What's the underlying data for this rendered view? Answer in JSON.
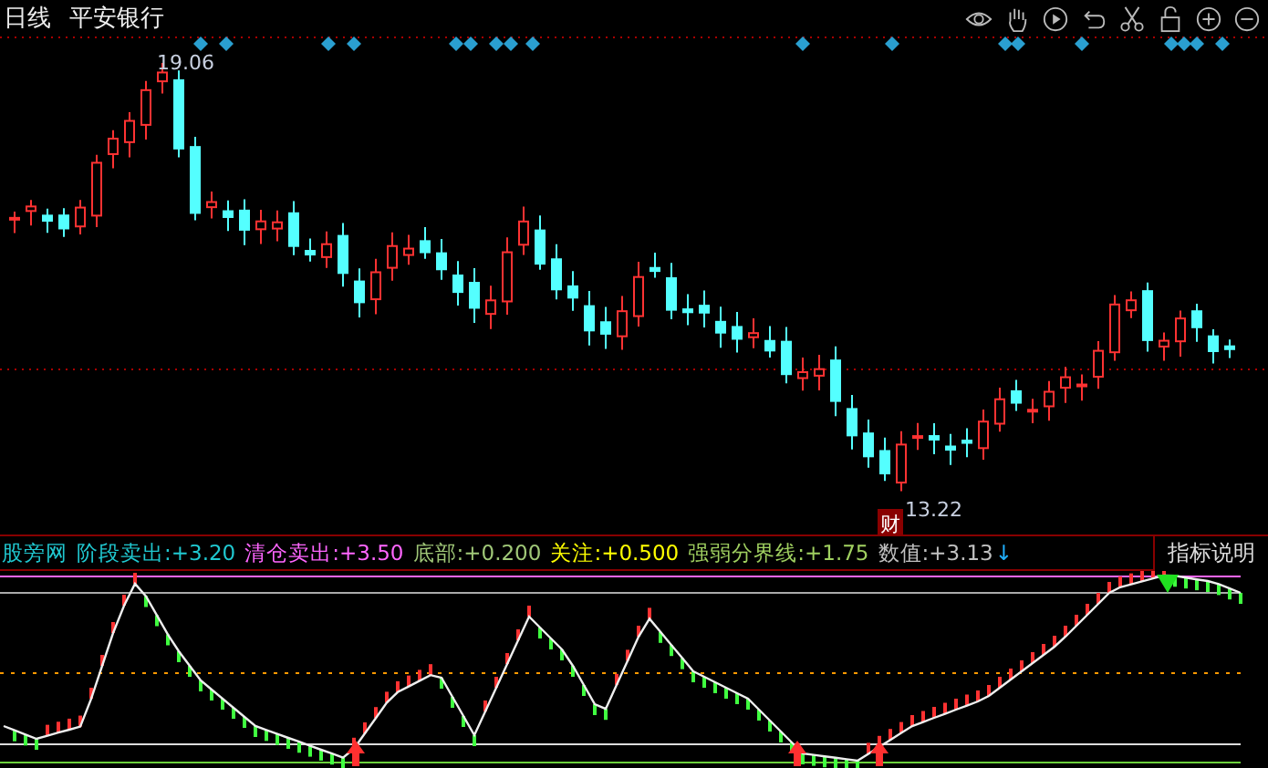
{
  "header": {
    "period": "日线",
    "stock": "平安银行"
  },
  "price_chart": {
    "high_label": "19.06",
    "low_label": "13.22",
    "event_badge": "财"
  },
  "indicator": {
    "items": [
      {
        "label": "股旁网",
        "value": "",
        "color": "#20c8d0"
      },
      {
        "label": "阶段卖出:",
        "value": "+3.20",
        "color": "#20c8d0"
      },
      {
        "label": "清仓卖出:",
        "value": "+3.50",
        "color": "#ff66ff"
      },
      {
        "label": "底部:",
        "value": "+0.200",
        "color": "#a0c878"
      },
      {
        "label": "关注:",
        "value": "+0.500",
        "color": "#ffff00"
      },
      {
        "label": "强弱分界线:",
        "value": "+1.75",
        "color": "#a0d060"
      },
      {
        "label": "数值:",
        "value": "+3.13",
        "color": "#c0c0c0"
      }
    ],
    "trend_arrow": "↓",
    "info_button": "指标说明"
  }
}
